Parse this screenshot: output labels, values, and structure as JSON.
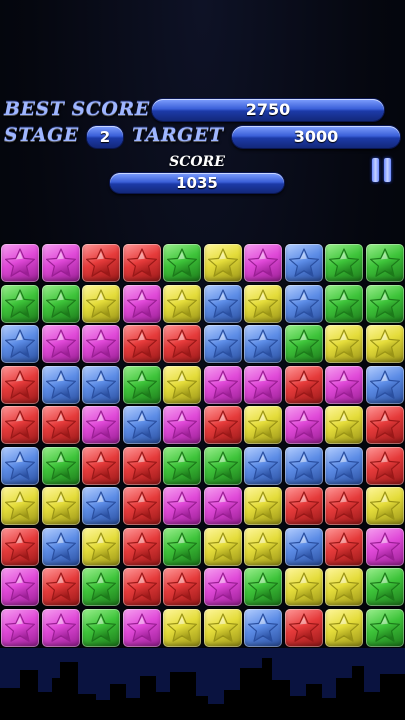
{
  "hud": {
    "best_score_label": "BEST SCORE",
    "best_score_value": "2750",
    "stage_label": "STAGE",
    "stage_value": "2",
    "target_label": "TARGET",
    "target_value": "3000",
    "score_label": "SCORE",
    "score_value": "1035"
  },
  "colors": {
    "P": {
      "base": "#e049d8",
      "light": "#f6a0f0",
      "dark": "#9a1e94"
    },
    "G": {
      "base": "#3ec43a",
      "light": "#9cf08f",
      "dark": "#1c7a1a"
    },
    "R": {
      "base": "#e63b3b",
      "light": "#ff9a9a",
      "dark": "#9a1818"
    },
    "Y": {
      "base": "#e4dc3a",
      "light": "#fff79e",
      "dark": "#9a9416"
    },
    "B": {
      "base": "#5c8ce6",
      "light": "#b5cfff",
      "dark": "#2a4fa0"
    }
  },
  "board": {
    "rows": [
      [
        "P",
        "P",
        "R",
        "R",
        "G",
        "Y",
        "P",
        "B",
        "G",
        "G"
      ],
      [
        "G",
        "G",
        "Y",
        "P",
        "Y",
        "B",
        "Y",
        "B",
        "G",
        "G"
      ],
      [
        "B",
        "P",
        "P",
        "R",
        "R",
        "B",
        "B",
        "G",
        "Y",
        "Y"
      ],
      [
        "R",
        "B",
        "B",
        "G",
        "Y",
        "P",
        "P",
        "R",
        "P",
        "B"
      ],
      [
        "R",
        "R",
        "P",
        "B",
        "P",
        "R",
        "Y",
        "P",
        "Y",
        "R"
      ],
      [
        "B",
        "G",
        "R",
        "R",
        "G",
        "G",
        "B",
        "B",
        "B",
        "R"
      ],
      [
        "Y",
        "Y",
        "B",
        "R",
        "P",
        "P",
        "Y",
        "R",
        "R",
        "Y"
      ],
      [
        "R",
        "B",
        "Y",
        "R",
        "G",
        "Y",
        "Y",
        "B",
        "R",
        "P"
      ],
      [
        "P",
        "R",
        "G",
        "R",
        "R",
        "P",
        "G",
        "Y",
        "Y",
        "G"
      ],
      [
        "P",
        "P",
        "G",
        "P",
        "Y",
        "Y",
        "B",
        "R",
        "Y",
        "G"
      ]
    ]
  }
}
